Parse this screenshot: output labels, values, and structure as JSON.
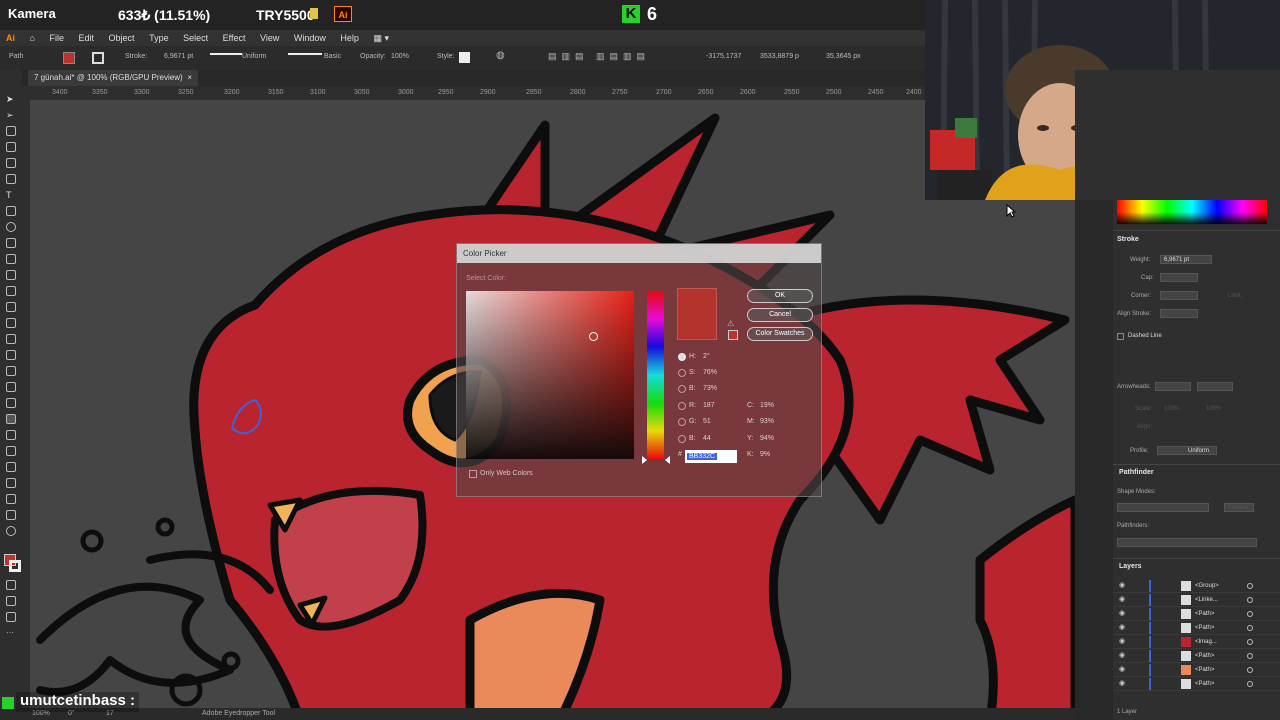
{
  "overlay": {
    "camera_label": "Kamera",
    "stat_percent": "633₺ (11.51%)",
    "stat_goal": "TRY5500",
    "app_badge": "Ai",
    "kick_logo": "K",
    "kick_count": "6"
  },
  "menu": [
    "File",
    "Edit",
    "Object",
    "Type",
    "Select",
    "Effect",
    "View",
    "Window",
    "Help"
  ],
  "controlbar": {
    "selection": "Path",
    "stroke_label": "Stroke:",
    "stroke_weight": "6,9671 pt",
    "profile": "Uniform",
    "brush": "Basic",
    "opacity_label": "Opacity:",
    "opacity": "100%",
    "style_label": "Style:",
    "x": "-3175,1737",
    "y": "3533,8879 p",
    "w": "35,3645 px"
  },
  "document": {
    "tab": "7 günah.ai* @ 100% (RGB/GPU Preview)",
    "close": "×"
  },
  "ruler": [
    "3400",
    "3350",
    "3300",
    "3250",
    "3200",
    "3150",
    "3100",
    "3050",
    "3000",
    "2950",
    "2900",
    "2850",
    "2800",
    "2750",
    "2700",
    "2650",
    "2600",
    "2550",
    "2500",
    "2450",
    "2400"
  ],
  "color_picker": {
    "title": "Color Picker",
    "select_color": "Select Color:",
    "ok": "OK",
    "cancel": "Cancel",
    "swatches": "Color Swatches",
    "h": "H:",
    "h_val": "2°",
    "s": "S:",
    "s_val": "76%",
    "b": "B:",
    "b_val": "73%",
    "r": "R:",
    "r_val": "187",
    "g": "G:",
    "g_val": "51",
    "bb": "B:",
    "bb_val": "44",
    "c": "C:",
    "c_val": "19%",
    "m": "M:",
    "m_val": "93%",
    "yy": "Y:",
    "yy_val": "94%",
    "k": "K:",
    "k_val": "9%",
    "hash": "#",
    "hex": "BB332C",
    "web_only": "Only Web Colors",
    "color": "#bb332c"
  },
  "panels": {
    "stroke": {
      "title": "Stroke",
      "weight_label": "Weight:",
      "weight": "6,9671 pt",
      "cap_label": "Cap:",
      "corner_label": "Corner:",
      "limit_label": "Limit:",
      "align_label": "Align Stroke:",
      "dashed": "Dashed Line",
      "arrowheads": "Arrowheads:",
      "scale": "Scale:",
      "scale_a": "100%",
      "scale_b": "100%",
      "align": "Align:",
      "profile_label": "Profile:",
      "profile": "Uniform"
    },
    "pathfinder": {
      "title": "Pathfinder",
      "shape_modes": "Shape Modes:",
      "expand": "Expand",
      "pathfinders": "Pathfinders:"
    },
    "layers": {
      "title": "Layers",
      "rows": [
        "<Group>",
        "<Linke...",
        "<Path>",
        "<Path>",
        "<Imag...",
        "<Path>",
        "<Path>",
        "<Path>"
      ],
      "footer": "1 Layer"
    }
  },
  "status": {
    "zoom": "100%",
    "angle": "0°",
    "artboard": "17",
    "tool": "Adobe Eyedropper Tool"
  },
  "chat": {
    "username": "umutcetinbass",
    "separator": ":"
  }
}
